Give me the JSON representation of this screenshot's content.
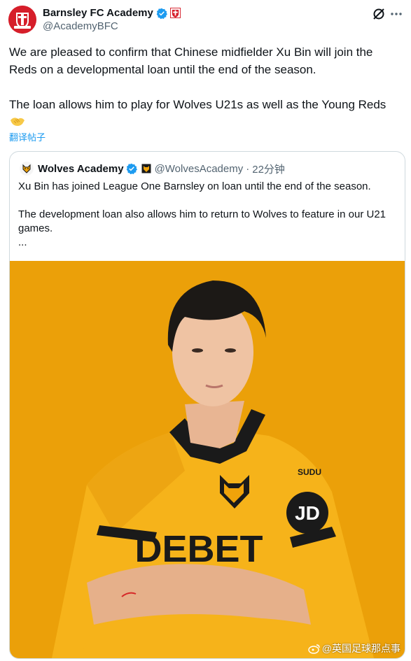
{
  "post": {
    "author_name": "Barnsley FC Academy",
    "author_handle": "@AcademyBFC",
    "paragraphs": [
      "We are pleased to confirm that Chinese midfielder Xu Bin will join the Reds on a developmental loan until the end of the season.",
      "The loan allows him to play for Wolves U21s as well as the Young Reds"
    ],
    "translate_label": "翻译帖子"
  },
  "quote": {
    "author_name": "Wolves Academy",
    "author_handle": "@WolvesAcademy",
    "separator": "·",
    "time": "22分钟",
    "paragraphs": [
      "Xu Bin has joined League One Barnsley on loan until the end of the season.",
      "The development loan also allows him to return to Wolves to feature in our U21 games.\n..."
    ]
  },
  "photo": {
    "shirt_sponsor": "DEBET",
    "sleeve_text": "JD",
    "brand_text": "SUDU"
  },
  "watermark": {
    "text": "@英国足球那点事"
  },
  "colors": {
    "link_blue": "#1d9bf0",
    "verified_blue": "#1d9bf0",
    "barnsley_red": "#d61e2a",
    "wolves_gold": "#f0a30a",
    "text_secondary": "#536471"
  },
  "icons": [
    "barnsley-crest-icon",
    "verified-badge-icon",
    "grok-icon",
    "more-icon",
    "handshake-emoji-icon",
    "wolves-crest-icon",
    "weibo-icon"
  ]
}
